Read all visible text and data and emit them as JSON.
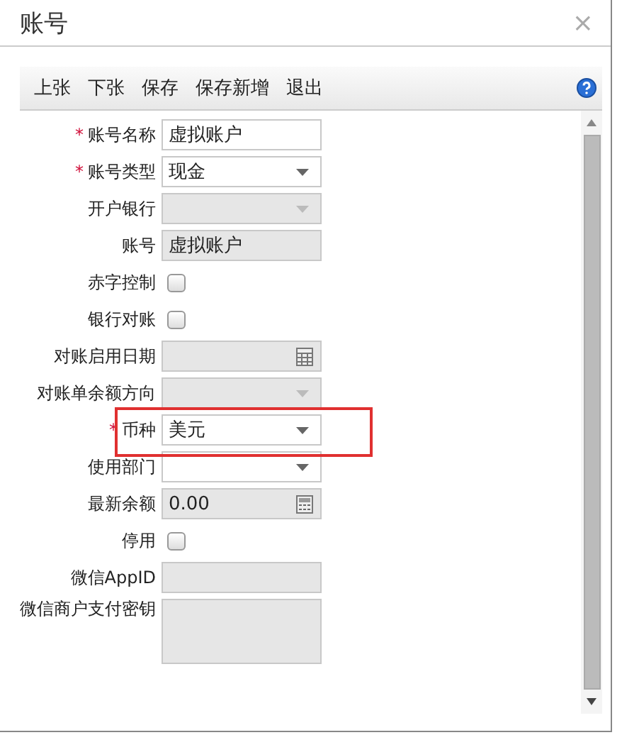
{
  "window": {
    "title": "账号",
    "close": "×"
  },
  "toolbar": {
    "buttons": [
      "上张",
      "下张",
      "保存",
      "保存新增",
      "退出"
    ]
  },
  "form": {
    "fields": [
      {
        "label": "账号名称",
        "required_mark": "*",
        "kind": "text",
        "disabled": false,
        "value": "虚拟账户",
        "highlighted": false
      },
      {
        "label": "账号类型",
        "required_mark": "*",
        "kind": "select",
        "disabled": false,
        "value": "现金",
        "highlighted": false
      },
      {
        "label": "开户银行",
        "kind": "select",
        "disabled": true,
        "highlighted": false
      },
      {
        "label": "账号",
        "kind": "text",
        "disabled": true,
        "value": "虚拟账户",
        "highlighted": false
      },
      {
        "label": "赤字控制",
        "kind": "checkbox",
        "checked": false,
        "highlighted": false
      },
      {
        "label": "银行对账",
        "kind": "checkbox",
        "checked": false,
        "highlighted": false
      },
      {
        "label": "对账启用日期",
        "kind": "date",
        "disabled": true,
        "highlighted": false
      },
      {
        "label": "对账单余额方向",
        "kind": "select",
        "disabled": true,
        "highlighted": false
      },
      {
        "label": "币种",
        "required_mark": "*",
        "kind": "select",
        "disabled": false,
        "value": "美元",
        "highlighted": true
      },
      {
        "label": "使用部门",
        "kind": "select",
        "disabled": false,
        "highlighted": false
      },
      {
        "label": "最新余额",
        "kind": "number",
        "disabled": true,
        "value": "0.00",
        "highlighted": false
      },
      {
        "label": "停用",
        "kind": "checkbox",
        "checked": false,
        "highlighted": false
      },
      {
        "label": "微信AppID",
        "kind": "text",
        "disabled": true,
        "highlighted": false
      },
      {
        "label": "微信商户支付密钥",
        "kind": "textarea",
        "disabled": true,
        "highlighted": false
      }
    ]
  }
}
